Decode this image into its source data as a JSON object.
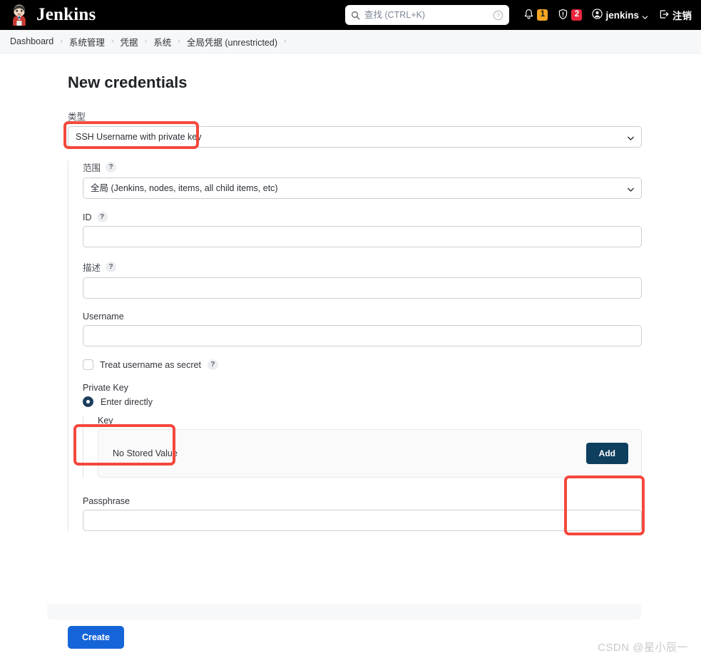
{
  "header": {
    "brand": "Jenkins",
    "search": {
      "placeholder": "查找 (CTRL+K)",
      "value": "",
      "icon": "search-icon",
      "help_icon": "question-circle-icon"
    },
    "notifications": {
      "icon": "bell-icon",
      "count": "1",
      "color": "#f5a623"
    },
    "security": {
      "icon": "shield-warning-icon",
      "count": "2",
      "color": "#e8273f"
    },
    "user": {
      "icon": "user-circle-icon",
      "name": "jenkins",
      "chevron": "chevron-down-icon"
    },
    "logout": {
      "icon": "logout-icon",
      "label": "注销"
    }
  },
  "breadcrumb": {
    "items": [
      "Dashboard",
      "系统管理",
      "凭据",
      "系统",
      "全局凭据 (unrestricted)"
    ],
    "separator": "›",
    "trailing_separator": "›"
  },
  "page": {
    "title": "New credentials"
  },
  "form": {
    "kind": {
      "label": "类型",
      "value": "SSH Username with private key",
      "chevron": "chevron-down-icon"
    },
    "scope": {
      "label": "范围",
      "help": "?",
      "value": "全局 (Jenkins, nodes, items, all child items, etc)",
      "chevron": "chevron-down-icon"
    },
    "id": {
      "label": "ID",
      "help": "?",
      "value": "",
      "placeholder": ""
    },
    "description": {
      "label": "描述",
      "help": "?",
      "value": "",
      "placeholder": ""
    },
    "username": {
      "label": "Username",
      "value": "",
      "placeholder": ""
    },
    "treat_secret": {
      "label": "Treat username as secret",
      "help": "?",
      "checked": false
    },
    "private_key": {
      "label": "Private Key",
      "option_label": "Enter directly",
      "selected": true,
      "key_label": "Key",
      "key_value": "No Stored Value",
      "add_label": "Add"
    },
    "passphrase": {
      "label": "Passphrase",
      "value": "",
      "placeholder": ""
    },
    "submit_label": "Create"
  },
  "watermark": "CSDN @星小辰一",
  "colors": {
    "header_bg": "#000000",
    "accent_blue": "#1565d8",
    "add_button": "#0f3f5f",
    "annotation_red": "#f4483d",
    "badge_orange": "#f5a623",
    "badge_red": "#e8273f"
  }
}
